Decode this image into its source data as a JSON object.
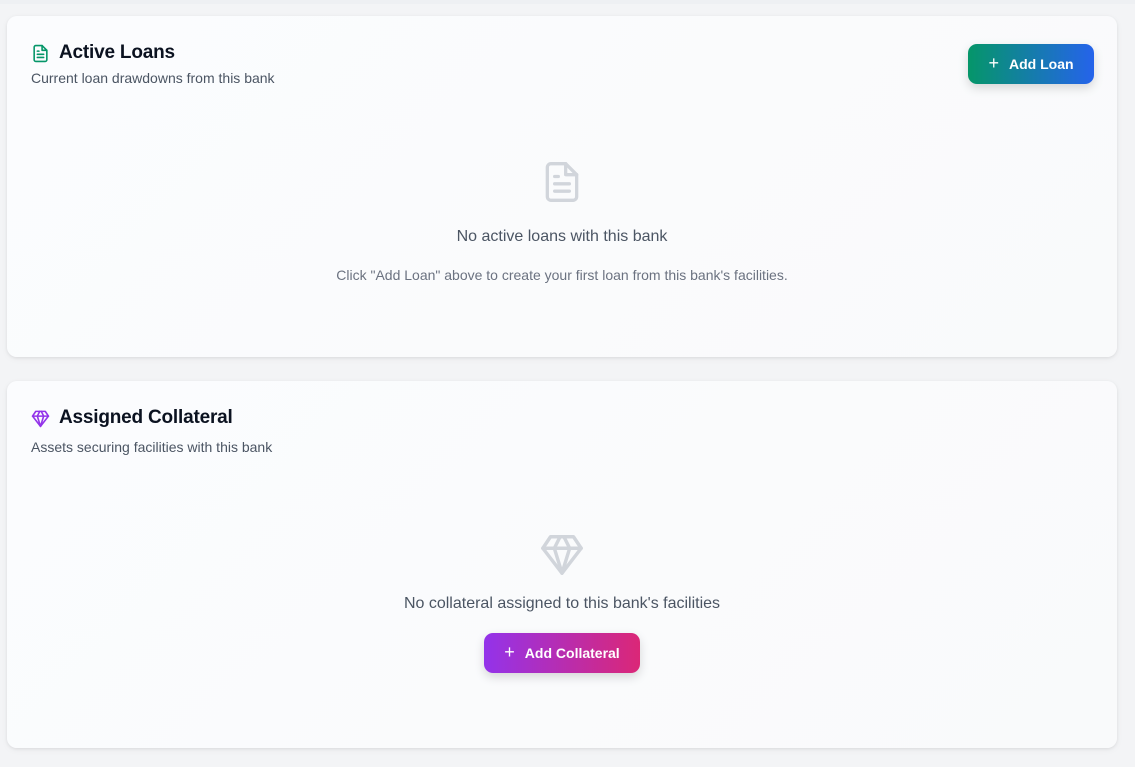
{
  "loans": {
    "title": "Active Loans",
    "subtitle": "Current loan drawdowns from this bank",
    "title_icon": "document-icon",
    "add_button": {
      "icon": "plus-icon",
      "label": "Add Loan"
    },
    "empty": {
      "icon": "document-icon",
      "title": "No active loans with this bank",
      "hint": "Click \"Add Loan\" above to create your first loan from this bank's facilities."
    }
  },
  "collateral": {
    "title": "Assigned Collateral",
    "subtitle": "Assets securing facilities with this bank",
    "title_icon": "gem-icon",
    "empty": {
      "icon": "gem-icon",
      "title": "No collateral assigned to this bank's facilities"
    },
    "add_button": {
      "icon": "plus-icon",
      "label": "Add Collateral"
    }
  },
  "colors": {
    "loan_accent": "#059669",
    "collateral_accent": "#9333ea",
    "loan_button_gradient": [
      "#059669",
      "#2563eb"
    ],
    "collateral_button_gradient": [
      "#9333ea",
      "#db2777"
    ],
    "empty_icon": "#d1d5db"
  }
}
